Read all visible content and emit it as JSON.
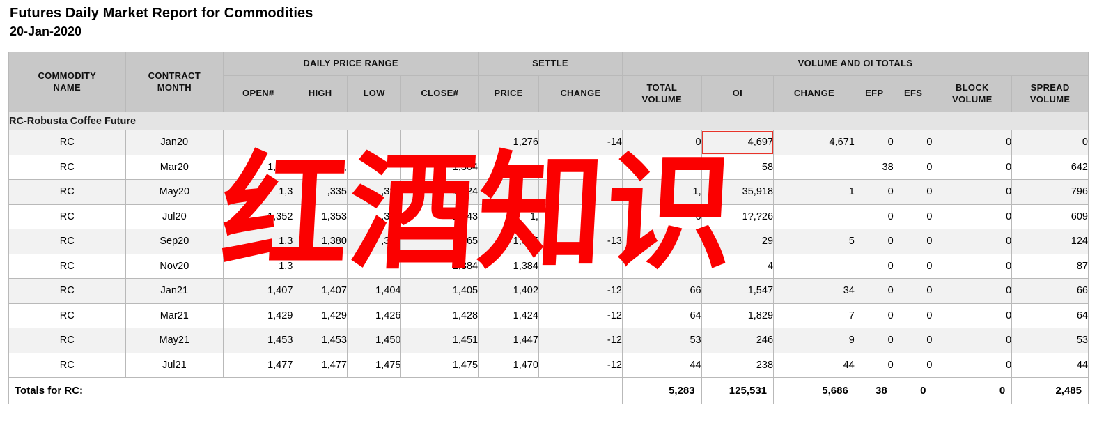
{
  "report": {
    "title": "Futures Daily Market Report for Commodities",
    "date": "20-Jan-2020"
  },
  "watermark": {
    "text": "红酒知识",
    "color": "#fb0000"
  },
  "highlight": {
    "color": "#e8342a",
    "cell": "row0.oi",
    "value": "4,697"
  },
  "table": {
    "group_headers": {
      "commodity_name": "COMMODITY\nNAME",
      "commodity_name_l1": "COMMODITY",
      "commodity_name_l2": "NAME",
      "contract_month_l1": "CONTRACT",
      "contract_month_l2": "MONTH",
      "daily_price_range": "DAILY PRICE RANGE",
      "settle": "SETTLE",
      "volume_and_oi_totals": "VOLUME AND OI TOTALS"
    },
    "sub_headers": {
      "open": "OPEN#",
      "high": "HIGH",
      "low": "LOW",
      "close": "CLOSE#",
      "price": "PRICE",
      "settle_change": "CHANGE",
      "total_volume_l1": "TOTAL",
      "total_volume_l2": "VOLUME",
      "oi": "OI",
      "oi_change": "CHANGE",
      "efp": "EFP",
      "efs": "EFS",
      "block_volume_l1": "BLOCK",
      "block_volume_l2": "VOLUME",
      "spread_volume_l1": "SPREAD",
      "spread_volume_l2": "VOLUME"
    },
    "section_label": "RC-Robusta Coffee Future",
    "rows": [
      {
        "commodity": "RC",
        "month": "Jan20",
        "open": "",
        "high": "",
        "low": "",
        "close": "",
        "price": "1,276",
        "change": "-14",
        "total_volume": "0",
        "oi": "4,697",
        "oi_change": "4,671",
        "efp": "0",
        "efs": "0",
        "block_volume": "0",
        "spread_volume": "0"
      },
      {
        "commodity": "RC",
        "month": "Mar20",
        "open": "1,316",
        "high": "1,",
        "low": "",
        "close": "1,304",
        "price": "",
        "change": "",
        "total_volume": "",
        "oi": "58",
        "oi_change": "",
        "efp": "38",
        "efs": "0",
        "block_volume": "0",
        "spread_volume": "642"
      },
      {
        "commodity": "RC",
        "month": "May20",
        "open": "1,3",
        "high": ",335",
        "low": ",323",
        "close": "1,324",
        "price": "",
        "change": "3",
        "total_volume": "1,",
        "oi": "35,918",
        "oi_change": "1",
        "efp": "0",
        "efs": "0",
        "block_volume": "0",
        "spread_volume": "796"
      },
      {
        "commodity": "RC",
        "month": "Jul20",
        "open": "1,352",
        "high": "1,353",
        "low": ",343",
        "close": "1,343",
        "price": "1,",
        "change": "",
        "total_volume": "6",
        "oi": "1?,?26",
        "oi_change": "",
        "efp": "0",
        "efs": "0",
        "block_volume": "0",
        "spread_volume": "609"
      },
      {
        "commodity": "RC",
        "month": "Sep20",
        "open": "1,3",
        "high": "1,380",
        "low": ",365",
        "close": "1,365",
        "price": "1,365",
        "change": "-13",
        "total_volume": "",
        "oi": "29",
        "oi_change": "5",
        "efp": "0",
        "efs": "0",
        "block_volume": "0",
        "spread_volume": "124"
      },
      {
        "commodity": "RC",
        "month": "Nov20",
        "open": "1,3",
        "high": "",
        "low": "",
        "close": "1,384",
        "price": "1,384",
        "change": "",
        "total_volume": "",
        "oi": "4",
        "oi_change": "",
        "efp": "0",
        "efs": "0",
        "block_volume": "0",
        "spread_volume": "87"
      },
      {
        "commodity": "RC",
        "month": "Jan21",
        "open": "1,407",
        "high": "1,407",
        "low": "1,404",
        "close": "1,405",
        "price": "1,402",
        "change": "-12",
        "total_volume": "66",
        "oi": "1,547",
        "oi_change": "34",
        "efp": "0",
        "efs": "0",
        "block_volume": "0",
        "spread_volume": "66"
      },
      {
        "commodity": "RC",
        "month": "Mar21",
        "open": "1,429",
        "high": "1,429",
        "low": "1,426",
        "close": "1,428",
        "price": "1,424",
        "change": "-12",
        "total_volume": "64",
        "oi": "1,829",
        "oi_change": "7",
        "efp": "0",
        "efs": "0",
        "block_volume": "0",
        "spread_volume": "64"
      },
      {
        "commodity": "RC",
        "month": "May21",
        "open": "1,453",
        "high": "1,453",
        "low": "1,450",
        "close": "1,451",
        "price": "1,447",
        "change": "-12",
        "total_volume": "53",
        "oi": "246",
        "oi_change": "9",
        "efp": "0",
        "efs": "0",
        "block_volume": "0",
        "spread_volume": "53"
      },
      {
        "commodity": "RC",
        "month": "Jul21",
        "open": "1,477",
        "high": "1,477",
        "low": "1,475",
        "close": "1,475",
        "price": "1,470",
        "change": "-12",
        "total_volume": "44",
        "oi": "238",
        "oi_change": "44",
        "efp": "0",
        "efs": "0",
        "block_volume": "0",
        "spread_volume": "44"
      }
    ],
    "totals": {
      "label": "Totals for RC:",
      "total_volume": "5,283",
      "oi": "125,531",
      "oi_change": "5,686",
      "efp": "38",
      "efs": "0",
      "block_volume": "0",
      "spread_volume": "2,485"
    }
  }
}
